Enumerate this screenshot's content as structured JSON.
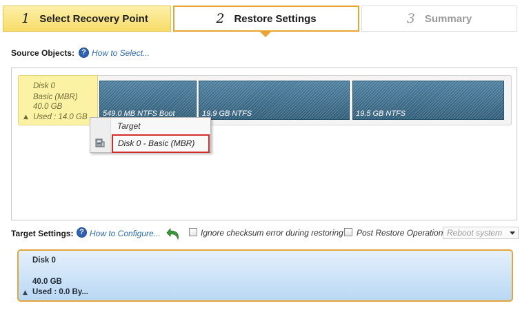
{
  "wizard": {
    "steps": [
      {
        "number": "1",
        "label": "Select Recovery Point",
        "state": "completed"
      },
      {
        "number": "2",
        "label": "Restore Settings",
        "state": "active"
      },
      {
        "number": "3",
        "label": "Summary",
        "state": "pending"
      }
    ]
  },
  "source": {
    "label": "Source Objects:",
    "help_link": "How to Select...",
    "disk": {
      "name": "Disk 0",
      "type": "Basic (MBR)",
      "size": "40.0 GB",
      "used": "Used : 14.0 GB"
    },
    "partitions": [
      {
        "label": "549.0 MB NTFS Boot"
      },
      {
        "label": "19.9 GB NTFS"
      },
      {
        "label": "19.5 GB NTFS"
      }
    ],
    "popup": {
      "title": "Target",
      "item": "Disk 0 - Basic (MBR)"
    }
  },
  "target": {
    "label": "Target Settings:",
    "help_link": "How to Configure...",
    "ignore_checksum_label": "Ignore checksum error during restoring",
    "ignore_checksum_checked": false,
    "post_restore_label": "Post Restore Operation",
    "post_restore_checked": false,
    "post_restore_option": "Reboot system",
    "card": {
      "name": "Disk 0",
      "size": "40.0 GB",
      "used": "Used : 0.0 By..."
    }
  },
  "colors": {
    "active_step_border": "#eaa432",
    "completed_step_bg": "#f7dc6a",
    "partition_fill": "#3b6c8a",
    "link": "#2e6cb5",
    "highlight_border": "#d42b2b",
    "target_card_bg": "#b9d8f4"
  }
}
